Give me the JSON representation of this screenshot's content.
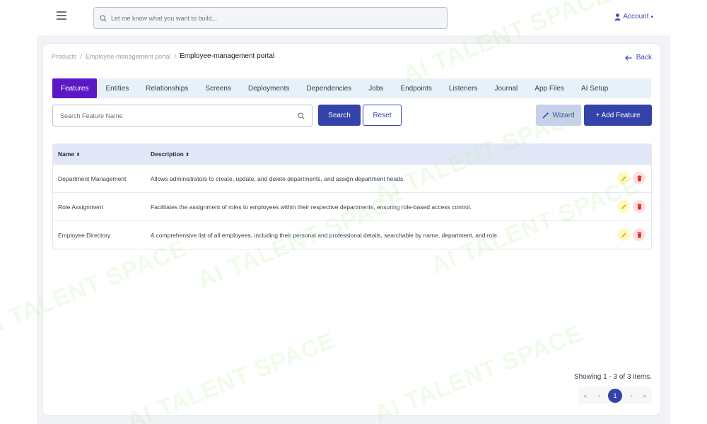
{
  "topbar": {
    "search_placeholder": "Let me know what you want to build...",
    "account_label": "Account"
  },
  "breadcrumb": {
    "items": [
      "Products",
      "Employee-management portal"
    ],
    "current": "Employee-management portal"
  },
  "back_label": "Back",
  "tabs": [
    {
      "label": "Features",
      "active": true
    },
    {
      "label": "Entities"
    },
    {
      "label": "Relationships"
    },
    {
      "label": "Screens"
    },
    {
      "label": "Deployments"
    },
    {
      "label": "Dependencies"
    },
    {
      "label": "Jobs"
    },
    {
      "label": "Endpoints"
    },
    {
      "label": "Listeners"
    },
    {
      "label": "Journal"
    },
    {
      "label": "App Files"
    },
    {
      "label": "AI Setup"
    }
  ],
  "feature_search": {
    "placeholder": "Search Feature Name",
    "search_label": "Search",
    "reset_label": "Reset"
  },
  "wizard_label": "Wizard",
  "add_feature_label": "+ Add Feature",
  "table": {
    "columns": [
      "Name",
      "Description"
    ],
    "rows": [
      {
        "name": "Department Management",
        "description": "Allows administrators to create, update, and delete departments, and assign department heads."
      },
      {
        "name": "Role Assignment",
        "description": "Facilitates the assignment of roles to employees within their respective departments, ensuring role-based access control."
      },
      {
        "name": "Employee Directory",
        "description": "A comprehensive list of all employees, including their personal and professional details, searchable by name, department, and role."
      }
    ]
  },
  "pagination": {
    "showing_text": "Showing 1 - 3 of 3 items.",
    "first": "«",
    "prev": "‹",
    "current_page": "1",
    "next": "›",
    "last": "»"
  },
  "watermark_text": "AI TALENT SPACE",
  "colors": {
    "primary": "#3443a8",
    "active_tab": "#5b18c5",
    "tab_bar": "#e8f1f8",
    "table_header": "#e1e7f7",
    "edit": "#e0b800",
    "delete": "#e02424"
  },
  "icons": [
    "hamburger-icon",
    "search-icon",
    "user-icon",
    "caret-down-icon",
    "arrow-left-icon",
    "sort-icon",
    "wand-icon",
    "pencil-icon",
    "trash-icon"
  ]
}
